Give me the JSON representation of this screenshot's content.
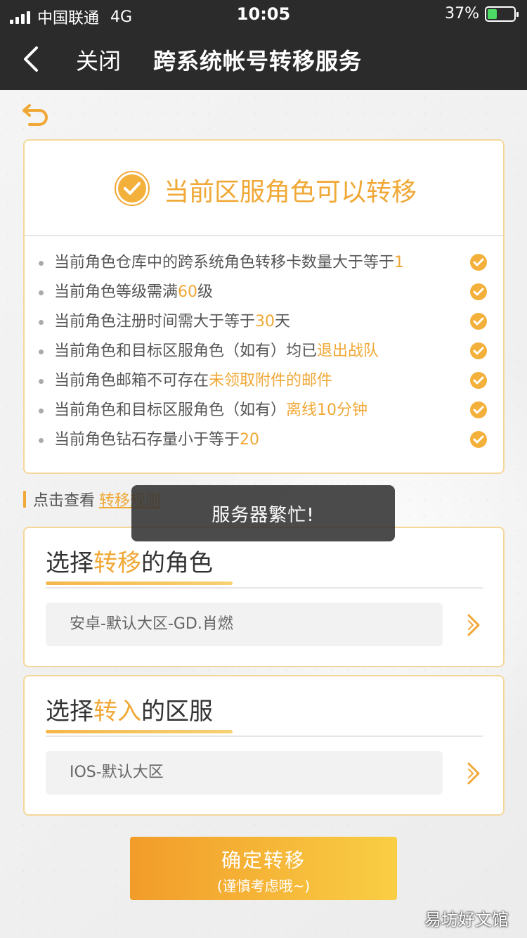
{
  "status_bar": {
    "carrier": "中国联通",
    "network": "4G",
    "time": "10:05",
    "battery_percent": "37%",
    "battery_level": 0.37
  },
  "nav": {
    "back_icon": "chevron-left-icon",
    "close_label": "关闭",
    "title": "跨系统帐号转移服务"
  },
  "status_card": {
    "icon": "check-circle-icon",
    "title": "当前区服角色可以转移",
    "requirements": [
      {
        "text": "当前角色仓库中的跨系统角色转移卡数量大于等于",
        "highlight": "1",
        "suffix": ""
      },
      {
        "text": "当前角色等级需满",
        "highlight": "60",
        "suffix": "级"
      },
      {
        "text": "当前角色注册时间需大于等于",
        "highlight": "30",
        "suffix": "天"
      },
      {
        "text": "当前角色和目标区服角色（如有）均已",
        "highlight": "退出战队",
        "suffix": ""
      },
      {
        "text": "当前角色邮箱不可存在",
        "highlight": "未领取附件的邮件",
        "suffix": ""
      },
      {
        "text": "当前角色和目标区服角色（如有）",
        "highlight": "离线10分钟",
        "suffix": ""
      },
      {
        "text": "当前角色钻石存量小于等于",
        "highlight": "20",
        "suffix": ""
      }
    ]
  },
  "rules": {
    "prefix": "点击查看",
    "link": "转移规则"
  },
  "toast": "服务器繁忙!",
  "role_select": {
    "title_pre": "选择",
    "title_hl": "转移",
    "title_post": "的角色",
    "value": "安卓-默认大区-GD.肖燃"
  },
  "server_select": {
    "title_pre": "选择",
    "title_hl": "转入",
    "title_post": "的区服",
    "value": "IOS-默认大区"
  },
  "confirm": {
    "label": "确定转移",
    "sub": "(谨慎考虑哦~)"
  },
  "watermark": "易坊好文馆",
  "colors": {
    "accent": "#f0a836",
    "nav_bg": "#2b2b2b",
    "card_border": "#f5d79a",
    "button_start": "#f29c2a",
    "button_end": "#f9ce44"
  }
}
